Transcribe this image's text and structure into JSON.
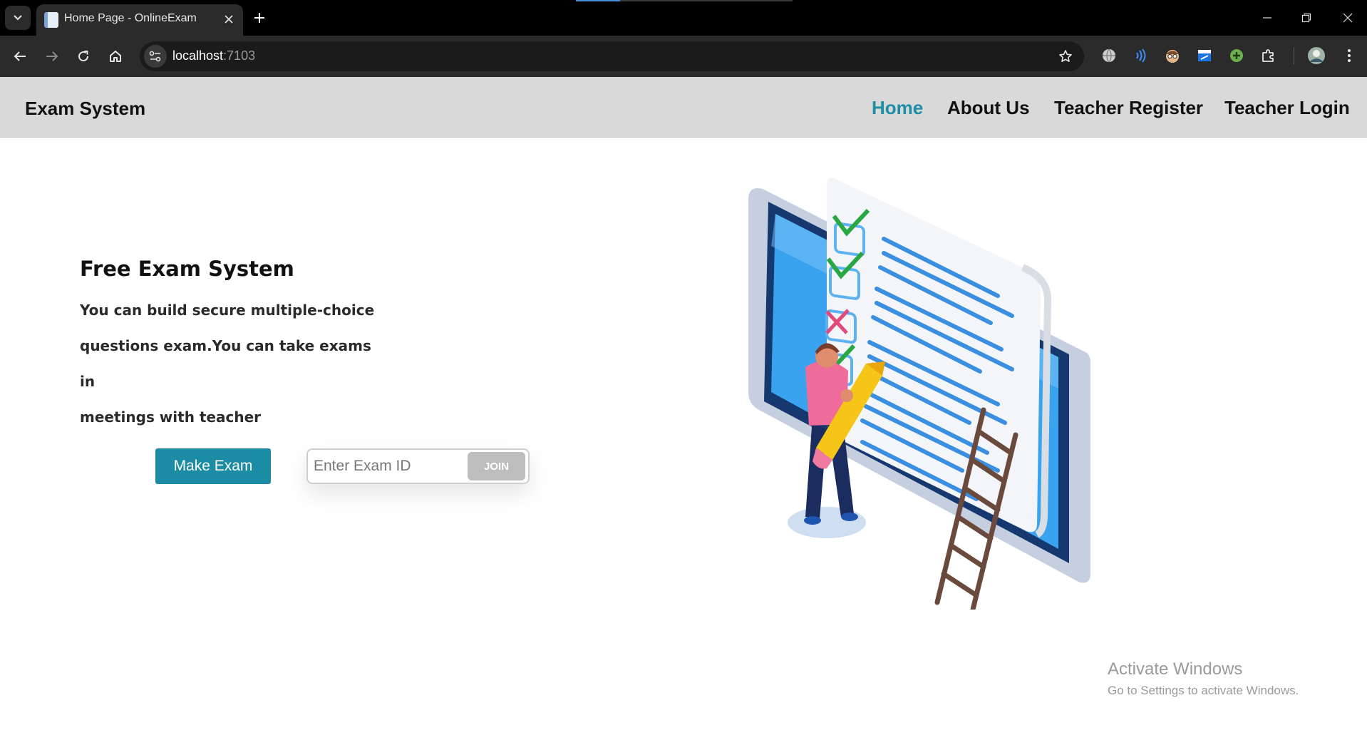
{
  "browser": {
    "tab_title": "Home Page - OnlineExam",
    "url_host": "localhost",
    "url_port": ":7103"
  },
  "site": {
    "brand": "Exam System",
    "nav": [
      {
        "label": "Home",
        "active": true
      },
      {
        "label": "About Us",
        "active": false
      },
      {
        "label": "Teacher Register",
        "active": false
      },
      {
        "label": "Teacher Login",
        "active": false
      }
    ]
  },
  "hero": {
    "title": "Free Exam System",
    "lines": [
      "You can build secure multiple-choice",
      "questions exam.You can take exams in",
      "meetings with teacher"
    ],
    "make_exam_label": "Make Exam",
    "exam_id_placeholder": "Enter Exam ID",
    "join_label": "JOIN"
  },
  "watermark": {
    "title": "Activate Windows",
    "subtitle": "Go to Settings to activate Windows."
  },
  "colors": {
    "accent": "#1b8ca4",
    "nav_bg": "#d9d9d9",
    "join_bg": "#bdbdbd"
  },
  "icons": [
    "tab-list-icon",
    "favicon-icon",
    "close-icon",
    "plus-icon",
    "back-arrow-icon",
    "forward-arrow-icon",
    "reload-icon",
    "home-icon",
    "site-info-icon",
    "star-icon",
    "globe-icon",
    "sound-icon",
    "face-icon",
    "flag-icon",
    "add-icon",
    "puzzle-icon",
    "profile-icon",
    "menu-dots-icon"
  ]
}
